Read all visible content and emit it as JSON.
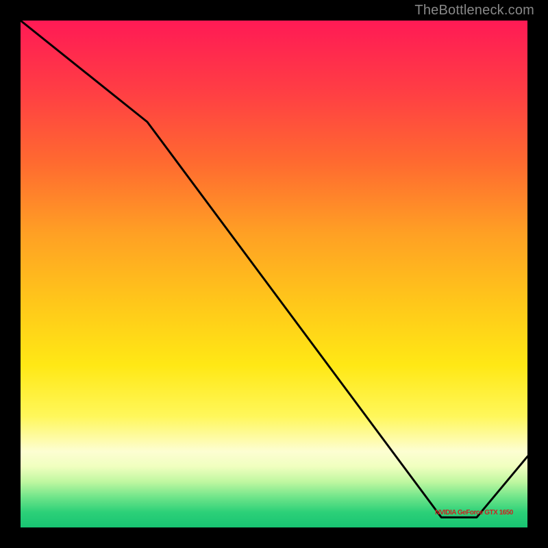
{
  "watermark": "TheBottleneck.com",
  "chart_data": {
    "type": "line",
    "title": "",
    "xlabel": "",
    "ylabel": "",
    "xlim": [
      0,
      100
    ],
    "ylim": [
      0,
      100
    ],
    "x": [
      0,
      25,
      83,
      90,
      100
    ],
    "values": [
      100,
      80,
      2,
      2,
      14
    ],
    "background_gradient_top": "#ff1a55",
    "background_gradient_bottom": "#18c472",
    "flat_segment": {
      "x_start": 83,
      "x_end": 90,
      "y": 2,
      "label": "NVIDIA GeForce GTX 1650"
    }
  },
  "colors": {
    "line": "#000000",
    "watermark": "#888888",
    "label": "#c22222"
  }
}
